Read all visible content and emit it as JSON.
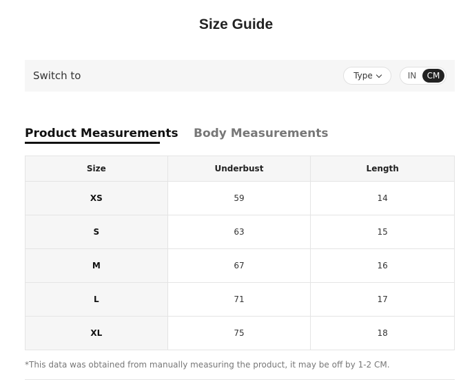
{
  "title": "Size Guide",
  "switch": {
    "label": "Switch to",
    "type_button": "Type",
    "units": [
      "IN",
      "CM"
    ],
    "selected_unit": "CM"
  },
  "tabs": [
    {
      "label": "Product Measurements",
      "active": true
    },
    {
      "label": "Body Measurements",
      "active": false
    }
  ],
  "table": {
    "headers": [
      "Size",
      "Underbust",
      "Length"
    ],
    "rows": [
      [
        "XS",
        "59",
        "14"
      ],
      [
        "S",
        "63",
        "15"
      ],
      [
        "M",
        "67",
        "16"
      ],
      [
        "L",
        "71",
        "17"
      ],
      [
        "XL",
        "75",
        "18"
      ]
    ]
  },
  "note": "*This data was obtained from manually measuring the product, it may be off by 1-2 CM.",
  "colors": {
    "accent": "#222222",
    "panel_bg": "#f6f6f6",
    "border": "#e4e4e4",
    "muted_text": "#777777"
  }
}
